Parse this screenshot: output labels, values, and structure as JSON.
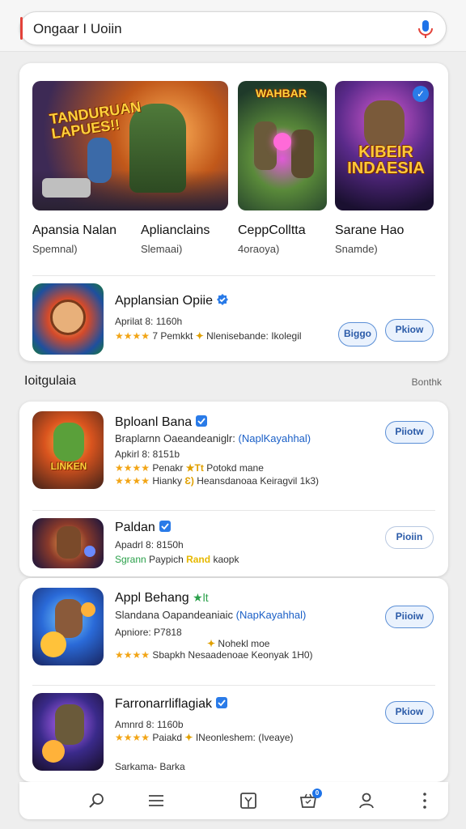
{
  "search": {
    "query": "Ongaar I Uoiin"
  },
  "featured": [
    {
      "title": "Apansia Nalan",
      "subtitle": "Spemnal)",
      "art_text": "TANDURUAN LAPUES!!"
    },
    {
      "title": "Aplianclains",
      "subtitle": "Slemaai)",
      "art_text": "WAHBAR"
    },
    {
      "title": "CeppColltta",
      "subtitle": "4oraoya)"
    },
    {
      "title": "Sarane Hao",
      "subtitle": "Snamde)",
      "art_text": "KIBEIR INDAESIA"
    }
  ],
  "highlight": {
    "name": "Applansian Opiie",
    "meta": "Aprilat 8: 1160h",
    "stars": "★★★★",
    "rating_text": "7 Pemkkt",
    "tags": "Nlenisebande:  Ikolegil",
    "btn_secondary": "Biggo",
    "btn_primary": "Pkiow"
  },
  "section": {
    "title": "Ioitgulaia",
    "more": "Bonthk"
  },
  "apps": [
    {
      "name": "Bploanl Bana",
      "desc": "Braplarnn Oaeandeaniglr:",
      "desc_link": "(NaplKayahhal)",
      "meta": "Apkirl 8: 8151b",
      "line1_stars": "★★★★",
      "line1_text": "Penakr",
      "line1_badge": "★Tt",
      "line1_more": "Potokd mane",
      "line2_stars": "★★★★",
      "line2_text": "Hianky",
      "line2_badge": "Ɛ)",
      "line2_more": "Heansdanoaa  Keiragvil   1k3)",
      "button": "Piiotw",
      "icon_text": "LINKEN"
    },
    {
      "name": "Paldan",
      "meta": "Apadrl 8: 8150h",
      "line1_green": "Sgrann",
      "line1_text": "Paypich",
      "line1_badge": "Rand",
      "line1_more": "kaopk",
      "button": "Pioiin"
    },
    {
      "name": "Appl Behang",
      "name_extra": "★lt",
      "desc": "Slandana Oapandeaniaic",
      "desc_link": "(NapKayahhal)",
      "meta": "Apniore: P7818",
      "line1_badge": "Nohekl moe",
      "line1_stars": "★★★★",
      "line1_text": "Sbapkh",
      "line1_more": "Nesaadenoae  Keonyak   1H0)",
      "button": "Piioiw"
    },
    {
      "name": "Farronarrliflagiak",
      "meta": "Amnrd 8: 1160b",
      "line1_stars": "★★★★",
      "line1_text": "Paiakd",
      "line1_more": "INeonleshem: (Iveaye)",
      "line2_text": "Sarkama-  Barka",
      "button": "Pkiow"
    }
  ],
  "nav": {
    "badge": "0"
  },
  "colors": {
    "accent": "#1a5fc7",
    "button_border": "#5b8fd6",
    "star": "#f2a516",
    "mic_blue": "#1e73e8",
    "mic_red": "#e3423a"
  }
}
